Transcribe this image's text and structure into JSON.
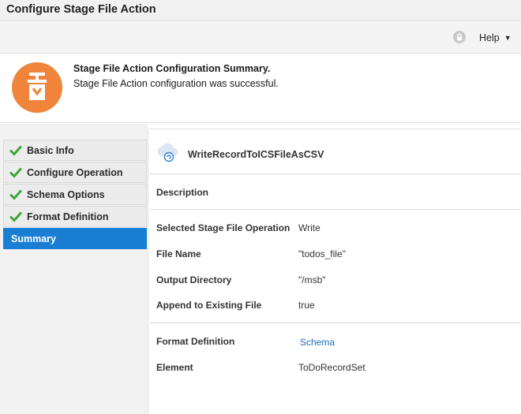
{
  "window": {
    "title": "Configure Stage File Action"
  },
  "toolbar": {
    "help_label": "Help",
    "lock_icon": "lock-icon",
    "caret_icon": "caret-down-icon"
  },
  "banner": {
    "icon": "stage-file-icon",
    "icon_color": "#f0843a",
    "title": "Stage File Action Configuration Summary.",
    "message": "Stage File Action configuration was successful."
  },
  "nav": {
    "check_color": "#3aa63a",
    "active_color": "#1a7fd4",
    "items": [
      {
        "label": "Basic Info",
        "completed": true
      },
      {
        "label": "Configure Operation",
        "completed": true
      },
      {
        "label": "Schema Options",
        "completed": true
      },
      {
        "label": "Format Definition",
        "completed": true
      },
      {
        "label": "Summary",
        "completed": false,
        "active": true
      }
    ]
  },
  "summary": {
    "action_name": "WriteRecordToICSFileAsCSV",
    "description_label": "Description",
    "operation": {
      "label": "Selected Stage File Operation",
      "value": "Write"
    },
    "file_name": {
      "label": "File Name",
      "value": "\"todos_file\""
    },
    "output_directory": {
      "label": "Output Directory",
      "value": "\"/msb\""
    },
    "append": {
      "label": "Append to Existing File",
      "value": "true"
    },
    "format_definition": {
      "label": "Format Definition",
      "value": "Schema"
    },
    "element": {
      "label": "Element",
      "value": "ToDoRecordSet"
    }
  }
}
